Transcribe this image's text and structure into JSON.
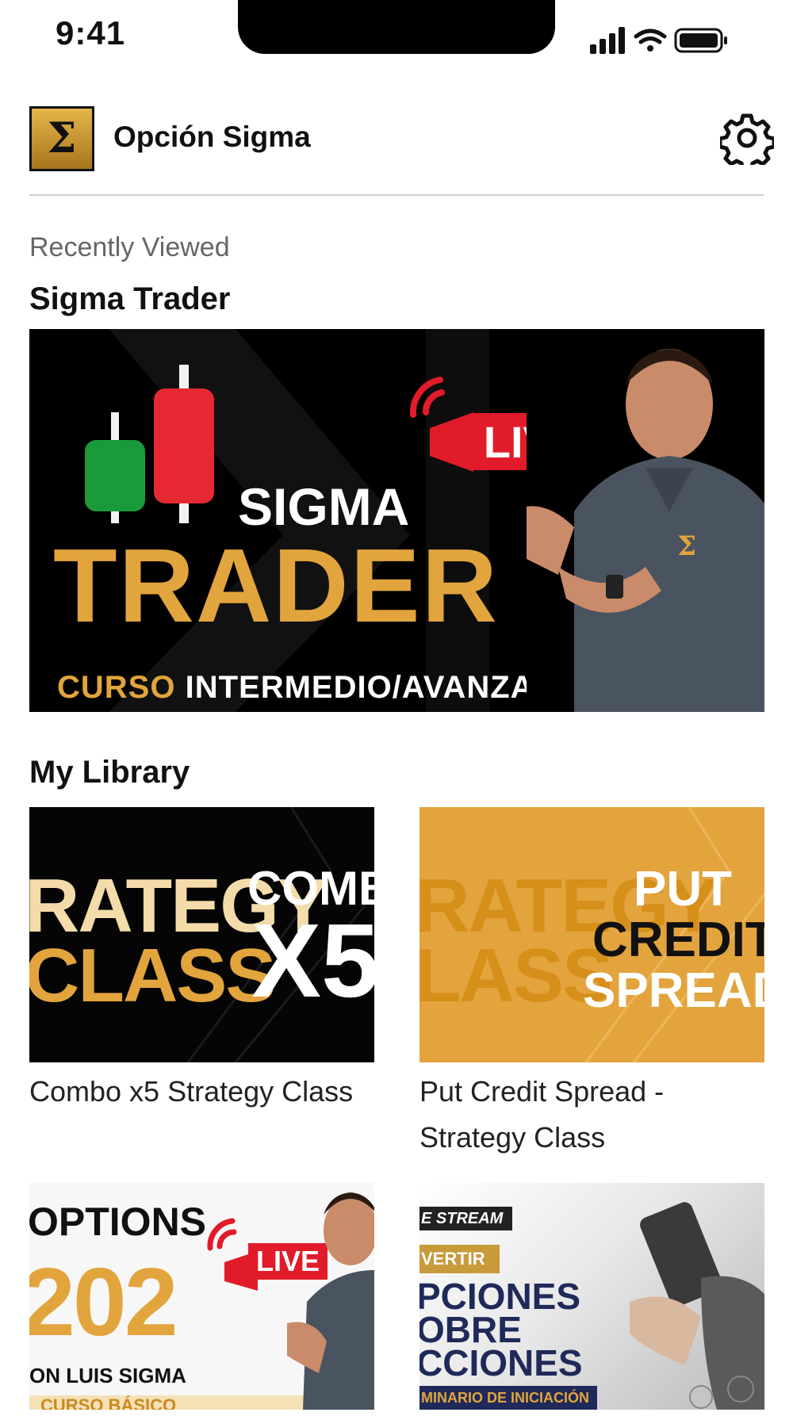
{
  "status_bar": {
    "time": "9:41"
  },
  "header": {
    "app_name": "Opción Sigma",
    "logo_symbol": "Σ"
  },
  "recently_viewed": {
    "label": "Recently Viewed",
    "title": "Sigma Trader",
    "hero": {
      "word1": "SIGMA",
      "word2": "TRADER",
      "sub_gold": "CURSO",
      "sub_white": "INTERMEDIO/AVANZADO",
      "live": "LIVE"
    }
  },
  "library": {
    "title": "My Library",
    "items": [
      {
        "title": "Combo x5 Strategy Class",
        "thumb_left_top": "RATEGY",
        "thumb_left_bottom": "CLASS",
        "thumb_right_top": "COMB",
        "thumb_right_bottom": "X5"
      },
      {
        "title": "Put Credit Spread - Strategy Class",
        "thumb_left_top": "RATEGY",
        "thumb_left_bottom": "LASS",
        "thumb_right_1": "PUT",
        "thumb_right_2": "CREDIT",
        "thumb_right_3": "SPREAD"
      },
      {
        "title": "",
        "thumb_top": "OPTIONS",
        "thumb_big": "202",
        "thumb_line": "ON LUIS SIGMA",
        "thumb_live": "LIVE",
        "thumb_bottom": "CURSO BÁSICO"
      },
      {
        "title": "",
        "thumb_stream": "E STREAM",
        "thumb_tag": "VERTIR",
        "thumb_l1": "PCIONES",
        "thumb_l2": "OBRE",
        "thumb_l3": "CCIONES",
        "thumb_bottom": "MINARIO DE INICIACIÓN"
      }
    ]
  },
  "colors": {
    "gold": "#e2a43c",
    "live_red": "#e21b2a",
    "divider": "#cfcfcf"
  }
}
